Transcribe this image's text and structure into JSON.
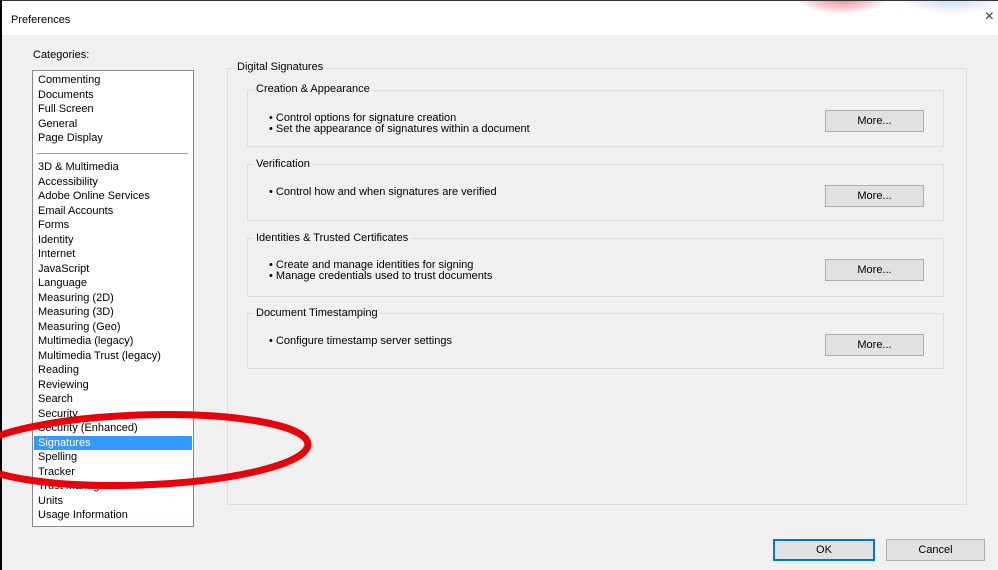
{
  "window": {
    "title": "Preferences",
    "close_glyph": "×"
  },
  "categories": {
    "label": "Categories:",
    "group1": [
      "Commenting",
      "Documents",
      "Full Screen",
      "General",
      "Page Display"
    ],
    "group2": [
      "3D & Multimedia",
      "Accessibility",
      "Adobe Online Services",
      "Email Accounts",
      "Forms",
      "Identity",
      "Internet",
      "JavaScript",
      "Language",
      "Measuring (2D)",
      "Measuring (3D)",
      "Measuring (Geo)",
      "Multimedia (legacy)",
      "Multimedia Trust (legacy)",
      "Reading",
      "Reviewing",
      "Search",
      "Security",
      "Security (Enhanced)",
      "Signatures",
      "Spelling",
      "Tracker",
      "Trust Manager",
      "Units",
      "Usage Information"
    ],
    "selected": "Signatures"
  },
  "panel": {
    "title": "Digital Signatures",
    "sections": [
      {
        "title": "Creation & Appearance",
        "lines": [
          "• Control options for signature creation",
          "• Set the appearance of signatures within a document"
        ],
        "button": "More..."
      },
      {
        "title": "Verification",
        "lines": [
          "• Control how and when signatures are verified"
        ],
        "button": "More..."
      },
      {
        "title": "Identities & Trusted Certificates",
        "lines": [
          "• Create and manage identities for signing",
          "• Manage credentials used to trust documents"
        ],
        "button": "More..."
      },
      {
        "title": "Document Timestamping",
        "lines": [
          "• Configure timestamp server settings"
        ],
        "button": "More..."
      }
    ]
  },
  "footer": {
    "ok_label": "OK",
    "cancel_label": "Cancel"
  },
  "colors": {
    "selection": "#3399ff",
    "annotation": "#e8000b",
    "ok_border": "#0078d7"
  }
}
